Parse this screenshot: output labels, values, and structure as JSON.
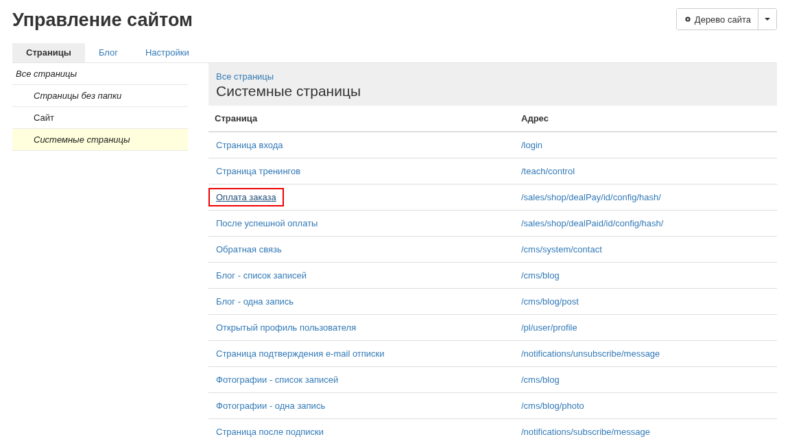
{
  "page_title": "Управление сайтом",
  "site_tree_button": {
    "label": "Дерево сайта"
  },
  "tabs": [
    {
      "label": "Страницы",
      "selected": true
    },
    {
      "label": "Блог",
      "selected": false
    },
    {
      "label": "Настройки",
      "selected": false
    }
  ],
  "sidebar": {
    "items": [
      {
        "label": "Все страницы",
        "italic": true,
        "selected": false,
        "children": [
          {
            "label": "Страницы без папки",
            "italic": true,
            "selected": false
          },
          {
            "label": "Сайт",
            "italic": false,
            "selected": false
          },
          {
            "label": "Системные страницы",
            "italic": true,
            "selected": true
          }
        ]
      }
    ]
  },
  "header": {
    "breadcrumb": "Все страницы",
    "title": "Системные страницы"
  },
  "table": {
    "columns": [
      "Страница",
      "Адрес"
    ],
    "rows": [
      {
        "page": "Страница входа",
        "address": "/login",
        "highlighted": false
      },
      {
        "page": "Страница тренингов",
        "address": "/teach/control",
        "highlighted": false
      },
      {
        "page": "Оплата заказа",
        "address": "/sales/shop/dealPay/id/config/hash/",
        "highlighted": true
      },
      {
        "page": "После успешной оплаты",
        "address": "/sales/shop/dealPaid/id/config/hash/",
        "highlighted": false
      },
      {
        "page": "Обратная связь",
        "address": "/cms/system/contact",
        "highlighted": false
      },
      {
        "page": "Блог - список записей",
        "address": "/cms/blog",
        "highlighted": false
      },
      {
        "page": "Блог - одна запись",
        "address": "/cms/blog/post",
        "highlighted": false
      },
      {
        "page": "Открытый профиль пользователя",
        "address": "/pl/user/profile",
        "highlighted": false
      },
      {
        "page": "Страница подтверждения e-mail отписки",
        "address": "/notifications/unsubscribe/message",
        "highlighted": false
      },
      {
        "page": "Фотографии - список записей",
        "address": "/cms/blog",
        "highlighted": false
      },
      {
        "page": "Фотографии - одна запись",
        "address": "/cms/blog/photo",
        "highlighted": false
      },
      {
        "page": "Страница после подписки",
        "address": "/notifications/subscribe/message",
        "highlighted": false
      }
    ]
  }
}
